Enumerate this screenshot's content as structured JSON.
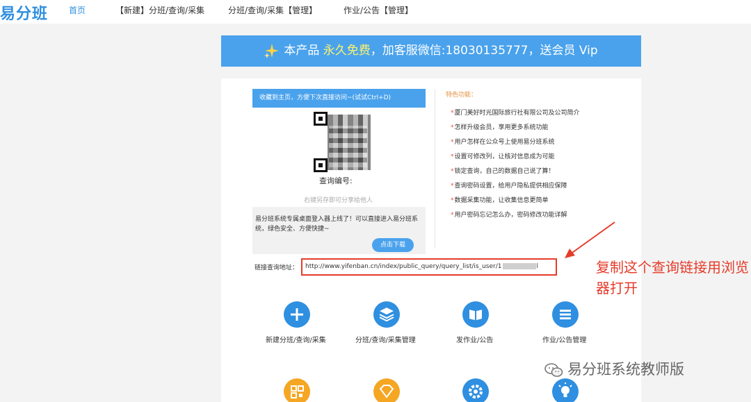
{
  "nav": {
    "logo": "易分班",
    "items": [
      "首页",
      "【新建】分班/查询/采集",
      "分班/查询/采集【管理】",
      "作业/公告【管理】"
    ]
  },
  "banner": {
    "prefix": "本产品 ",
    "highlight": "永久免费",
    "suffix": "，加客服微信:18030135777，送会员 Vip"
  },
  "left": {
    "save_bar": "收藏到主页，方便下次直接访问~(试试Ctrl+D)",
    "query_no_label": "查询编号:",
    "share_hint": "右键另存即可分享给他人",
    "login_text": "易分班系统专属桌面登入器上线了！可以直接进入易分班系统，绿色安全、方便快捷~",
    "download_button": "点击下载"
  },
  "features": {
    "title": "特色功能：",
    "items": [
      "厦门美好时光国际旅行社有限公司及公司简介",
      "怎样升级会员，享用更多系统功能",
      "用户怎样在公众号上使用易分班系统",
      "设置可修改列，让核对信息成为可能",
      "锁定查询，自己的数据自己说了算！",
      "查询密码设置，给用户隐私提供相应保障",
      "数据采集功能，让收集信息更简单",
      "用户密码忘记怎么办，密码修改功能详解"
    ]
  },
  "link": {
    "label": "链接查询地址：",
    "value": "http://www.yifenban.cn/index/public_query/query_list/is_user/1",
    "tail": "l"
  },
  "annotation": "复制这个查询链接用浏览器打开",
  "tiles": [
    "新建分班/查询/采集",
    "分班/查询/采集管理",
    "发作业/公告",
    "作业/公告管理"
  ],
  "watermark": "易分班系统教师版",
  "colors": {
    "primary": "#4aa2ec",
    "nav_active": "#2f8fe0",
    "highlight": "#fff36b",
    "annotation": "#e53b2a",
    "feature_title": "#e6913d",
    "tile_orange": "#f5a623"
  }
}
